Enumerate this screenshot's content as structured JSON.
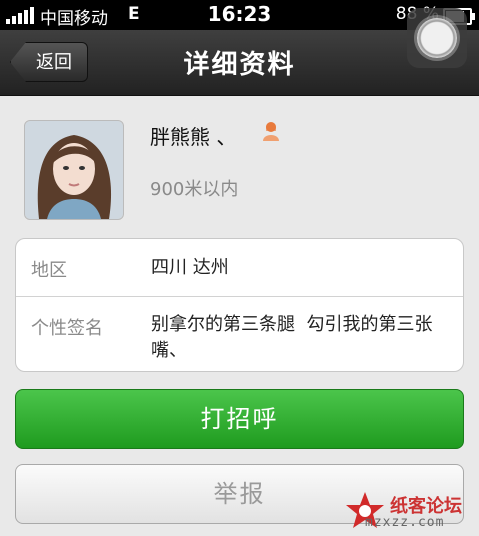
{
  "status_bar": {
    "carrier": "中国移动",
    "network": "E",
    "time": "16:23",
    "battery": "88 %",
    "battery_level": 0.88
  },
  "nav": {
    "back_label": "返回",
    "title": "详细资料"
  },
  "profile": {
    "name": "胖熊熊 、",
    "distance": "900米以内",
    "gender_icon": "female-user-icon"
  },
  "info": {
    "region_label": "地区",
    "region_value": "四川 达州",
    "signature_label": "个性签名",
    "signature_value": "别拿尔的第三条腿  勾引我的第三张嘴、"
  },
  "buttons": {
    "greet": "打招呼",
    "report": "举报"
  },
  "watermark": {
    "text": "纸客论坛",
    "url": "mzxzz.com"
  },
  "colors": {
    "primary_green": "#2aa92a",
    "nav_background": "#2b2b2b"
  }
}
